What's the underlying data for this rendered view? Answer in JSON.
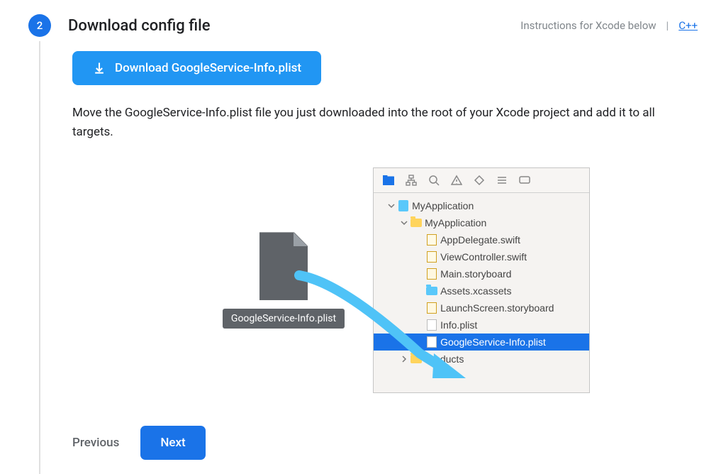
{
  "step": {
    "number": "2",
    "title": "Download config file",
    "instructions_text": "Instructions for Xcode below",
    "cpp_link": "C++"
  },
  "download": {
    "button_label": "Download GoogleService-Info.plist"
  },
  "description": "Move the GoogleService-Info.plist file you just downloaded into the root of your Xcode project and add it to all targets.",
  "file": {
    "label": "GoogleService-Info.plist"
  },
  "xcode": {
    "root": "MyApplication",
    "folder": "MyApplication",
    "files": {
      "app_delegate": "AppDelegate.swift",
      "view_controller": "ViewController.swift",
      "main_sb": "Main.storyboard",
      "assets": "Assets.xcassets",
      "launch_sb": "LaunchScreen.storyboard",
      "info_plist": "Info.plist",
      "gs_info": "GoogleService-Info.plist",
      "products": "Products"
    }
  },
  "actions": {
    "previous": "Previous",
    "next": "Next"
  }
}
